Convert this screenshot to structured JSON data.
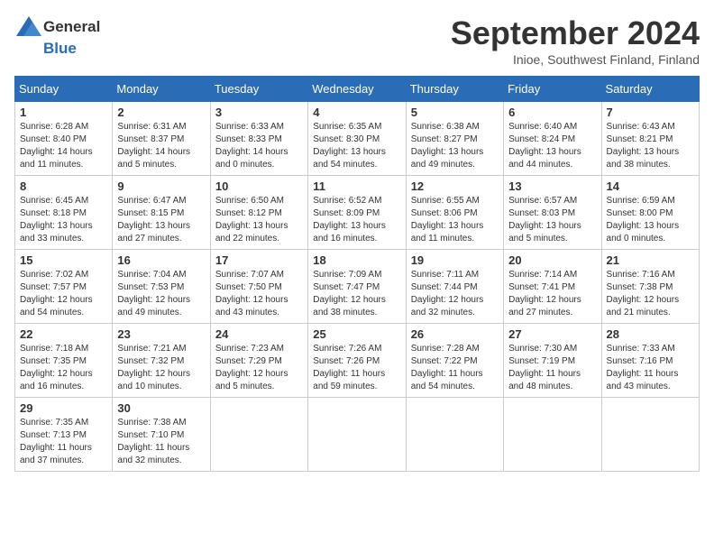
{
  "header": {
    "logo_general": "General",
    "logo_blue": "Blue",
    "month_title": "September 2024",
    "location": "Inioe, Southwest Finland, Finland"
  },
  "weekdays": [
    "Sunday",
    "Monday",
    "Tuesday",
    "Wednesday",
    "Thursday",
    "Friday",
    "Saturday"
  ],
  "weeks": [
    [
      {
        "day": "1",
        "info": "Sunrise: 6:28 AM\nSunset: 8:40 PM\nDaylight: 14 hours and 11 minutes."
      },
      {
        "day": "2",
        "info": "Sunrise: 6:31 AM\nSunset: 8:37 PM\nDaylight: 14 hours and 5 minutes."
      },
      {
        "day": "3",
        "info": "Sunrise: 6:33 AM\nSunset: 8:33 PM\nDaylight: 14 hours and 0 minutes."
      },
      {
        "day": "4",
        "info": "Sunrise: 6:35 AM\nSunset: 8:30 PM\nDaylight: 13 hours and 54 minutes."
      },
      {
        "day": "5",
        "info": "Sunrise: 6:38 AM\nSunset: 8:27 PM\nDaylight: 13 hours and 49 minutes."
      },
      {
        "day": "6",
        "info": "Sunrise: 6:40 AM\nSunset: 8:24 PM\nDaylight: 13 hours and 44 minutes."
      },
      {
        "day": "7",
        "info": "Sunrise: 6:43 AM\nSunset: 8:21 PM\nDaylight: 13 hours and 38 minutes."
      }
    ],
    [
      {
        "day": "8",
        "info": "Sunrise: 6:45 AM\nSunset: 8:18 PM\nDaylight: 13 hours and 33 minutes."
      },
      {
        "day": "9",
        "info": "Sunrise: 6:47 AM\nSunset: 8:15 PM\nDaylight: 13 hours and 27 minutes."
      },
      {
        "day": "10",
        "info": "Sunrise: 6:50 AM\nSunset: 8:12 PM\nDaylight: 13 hours and 22 minutes."
      },
      {
        "day": "11",
        "info": "Sunrise: 6:52 AM\nSunset: 8:09 PM\nDaylight: 13 hours and 16 minutes."
      },
      {
        "day": "12",
        "info": "Sunrise: 6:55 AM\nSunset: 8:06 PM\nDaylight: 13 hours and 11 minutes."
      },
      {
        "day": "13",
        "info": "Sunrise: 6:57 AM\nSunset: 8:03 PM\nDaylight: 13 hours and 5 minutes."
      },
      {
        "day": "14",
        "info": "Sunrise: 6:59 AM\nSunset: 8:00 PM\nDaylight: 13 hours and 0 minutes."
      }
    ],
    [
      {
        "day": "15",
        "info": "Sunrise: 7:02 AM\nSunset: 7:57 PM\nDaylight: 12 hours and 54 minutes."
      },
      {
        "day": "16",
        "info": "Sunrise: 7:04 AM\nSunset: 7:53 PM\nDaylight: 12 hours and 49 minutes."
      },
      {
        "day": "17",
        "info": "Sunrise: 7:07 AM\nSunset: 7:50 PM\nDaylight: 12 hours and 43 minutes."
      },
      {
        "day": "18",
        "info": "Sunrise: 7:09 AM\nSunset: 7:47 PM\nDaylight: 12 hours and 38 minutes."
      },
      {
        "day": "19",
        "info": "Sunrise: 7:11 AM\nSunset: 7:44 PM\nDaylight: 12 hours and 32 minutes."
      },
      {
        "day": "20",
        "info": "Sunrise: 7:14 AM\nSunset: 7:41 PM\nDaylight: 12 hours and 27 minutes."
      },
      {
        "day": "21",
        "info": "Sunrise: 7:16 AM\nSunset: 7:38 PM\nDaylight: 12 hours and 21 minutes."
      }
    ],
    [
      {
        "day": "22",
        "info": "Sunrise: 7:18 AM\nSunset: 7:35 PM\nDaylight: 12 hours and 16 minutes."
      },
      {
        "day": "23",
        "info": "Sunrise: 7:21 AM\nSunset: 7:32 PM\nDaylight: 12 hours and 10 minutes."
      },
      {
        "day": "24",
        "info": "Sunrise: 7:23 AM\nSunset: 7:29 PM\nDaylight: 12 hours and 5 minutes."
      },
      {
        "day": "25",
        "info": "Sunrise: 7:26 AM\nSunset: 7:26 PM\nDaylight: 11 hours and 59 minutes."
      },
      {
        "day": "26",
        "info": "Sunrise: 7:28 AM\nSunset: 7:22 PM\nDaylight: 11 hours and 54 minutes."
      },
      {
        "day": "27",
        "info": "Sunrise: 7:30 AM\nSunset: 7:19 PM\nDaylight: 11 hours and 48 minutes."
      },
      {
        "day": "28",
        "info": "Sunrise: 7:33 AM\nSunset: 7:16 PM\nDaylight: 11 hours and 43 minutes."
      }
    ],
    [
      {
        "day": "29",
        "info": "Sunrise: 7:35 AM\nSunset: 7:13 PM\nDaylight: 11 hours and 37 minutes."
      },
      {
        "day": "30",
        "info": "Sunrise: 7:38 AM\nSunset: 7:10 PM\nDaylight: 11 hours and 32 minutes."
      },
      {
        "day": "",
        "info": ""
      },
      {
        "day": "",
        "info": ""
      },
      {
        "day": "",
        "info": ""
      },
      {
        "day": "",
        "info": ""
      },
      {
        "day": "",
        "info": ""
      }
    ]
  ]
}
